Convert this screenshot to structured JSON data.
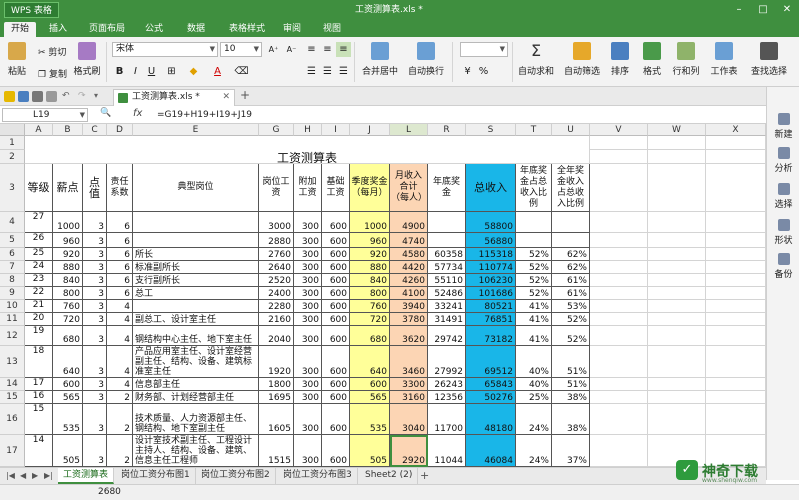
{
  "app": {
    "badge": "WPS 表格",
    "window_title": "工资测算表.xls *"
  },
  "menu_tabs": [
    "开始",
    "插入",
    "页面布局",
    "公式",
    "数据",
    "表格样式",
    "审阅",
    "视图"
  ],
  "ribbon": {
    "paste": "粘贴",
    "cut": "剪切",
    "copy": "复制",
    "format_painter": "格式刷",
    "font_name": "宋体",
    "font_size": "10",
    "merge_center": "合并居中",
    "wrap_text": "自动换行",
    "auto_sum": "自动求和",
    "auto_filter": "自动筛选",
    "sort": "排序",
    "format": "格式",
    "row_col": "行和列",
    "worksheet": "工作表",
    "find_select": "查找选择",
    "percent": "%"
  },
  "doc_tab": "工资测算表.xls *",
  "formula_bar": {
    "name_box": "L19",
    "fx": "fx",
    "formula": "=G19+H19+I19+J19"
  },
  "right_sidebar": [
    "新建",
    "分析",
    "选择",
    "形状",
    "备份"
  ],
  "columns": [
    "A",
    "B",
    "C",
    "D",
    "E",
    "G",
    "H",
    "I",
    "J",
    "L",
    "R",
    "S",
    "T",
    "U",
    "V",
    "W",
    "X"
  ],
  "sheet_title": "工资测算表",
  "headers": {
    "a": "等级",
    "b": "薪点",
    "c": "点值",
    "d": "责任系数",
    "e": "典型岗位",
    "g": "岗位工资",
    "h": "附加工资",
    "i": "基础工资",
    "j": "季度奖金（每月）",
    "l": "月收入合计（每人）",
    "r": "年底奖金",
    "s": "总收入",
    "t": "年底奖金占总收入比例",
    "u": "全年奖金收入占总收入比例"
  },
  "rows": [
    {
      "row": "4",
      "a": "27",
      "b": "1000",
      "c": "3",
      "d": "6",
      "e": "",
      "g": "3000",
      "h": "300",
      "i": "600",
      "j": "1000",
      "l": "4900",
      "r": "",
      "s": "58800",
      "t": "",
      "u": ""
    },
    {
      "row": "5",
      "a": "26",
      "b": "960",
      "c": "3",
      "d": "6",
      "e": "",
      "g": "2880",
      "h": "300",
      "i": "600",
      "j": "960",
      "l": "4740",
      "r": "",
      "s": "56880",
      "t": "",
      "u": ""
    },
    {
      "row": "6",
      "a": "25",
      "b": "920",
      "c": "3",
      "d": "6",
      "e": "所长",
      "g": "2760",
      "h": "300",
      "i": "600",
      "j": "920",
      "l": "4580",
      "r": "60358",
      "s": "115318",
      "t": "52%",
      "u": "62%"
    },
    {
      "row": "7",
      "a": "24",
      "b": "880",
      "c": "3",
      "d": "6",
      "e": "标准副所长",
      "g": "2640",
      "h": "300",
      "i": "600",
      "j": "880",
      "l": "4420",
      "r": "57734",
      "s": "110774",
      "t": "52%",
      "u": "62%"
    },
    {
      "row": "8",
      "a": "23",
      "b": "840",
      "c": "3",
      "d": "6",
      "e": "支行副所长",
      "g": "2520",
      "h": "300",
      "i": "600",
      "j": "840",
      "l": "4260",
      "r": "55110",
      "s": "106230",
      "t": "52%",
      "u": "61%"
    },
    {
      "row": "9",
      "a": "22",
      "b": "800",
      "c": "3",
      "d": "6",
      "e": "总工",
      "g": "2400",
      "h": "300",
      "i": "600",
      "j": "800",
      "l": "4100",
      "r": "52486",
      "s": "101686",
      "t": "52%",
      "u": "61%"
    },
    {
      "row": "10",
      "a": "21",
      "b": "760",
      "c": "3",
      "d": "4",
      "e": "",
      "g": "2280",
      "h": "300",
      "i": "600",
      "j": "760",
      "l": "3940",
      "r": "33241",
      "s": "80521",
      "t": "41%",
      "u": "53%"
    },
    {
      "row": "11",
      "a": "20",
      "b": "720",
      "c": "3",
      "d": "4",
      "e": "副总工、设计室主任",
      "g": "2160",
      "h": "300",
      "i": "600",
      "j": "720",
      "l": "3780",
      "r": "31491",
      "s": "76851",
      "t": "41%",
      "u": "52%"
    },
    {
      "row": "12",
      "a": "19",
      "b": "680",
      "c": "3",
      "d": "4",
      "e": "钢结构中心主任、地下室主任",
      "g": "2040",
      "h": "300",
      "i": "600",
      "j": "680",
      "l": "3620",
      "r": "29742",
      "s": "73182",
      "t": "41%",
      "u": "52%"
    },
    {
      "row": "13",
      "a": "18",
      "b": "640",
      "c": "3",
      "d": "4",
      "e": "产品应用室主任、设计室经营副主任、结构、设备、建筑标准室主任",
      "g": "1920",
      "h": "300",
      "i": "600",
      "j": "640",
      "l": "3460",
      "r": "27992",
      "s": "69512",
      "t": "40%",
      "u": "51%"
    },
    {
      "row": "14",
      "a": "17",
      "b": "600",
      "c": "3",
      "d": "4",
      "e": "信息部主任",
      "g": "1800",
      "h": "300",
      "i": "600",
      "j": "600",
      "l": "3300",
      "r": "26243",
      "s": "65843",
      "t": "40%",
      "u": "51%"
    },
    {
      "row": "15",
      "a": "16",
      "b": "565",
      "c": "3",
      "d": "2",
      "e": "财务部、计划经营部主任",
      "g": "1695",
      "h": "300",
      "i": "600",
      "j": "565",
      "l": "3160",
      "r": "12356",
      "s": "50276",
      "t": "25%",
      "u": "38%"
    },
    {
      "row": "16",
      "a": "15",
      "b": "535",
      "c": "3",
      "d": "2",
      "e": "技术质量、人力资源部主任、钢结构、地下室副主任",
      "g": "1605",
      "h": "300",
      "i": "600",
      "j": "535",
      "l": "3040",
      "r": "11700",
      "s": "48180",
      "t": "24%",
      "u": "38%"
    },
    {
      "row": "17",
      "a": "14",
      "b": "505",
      "c": "3",
      "d": "2",
      "e": "设计室技术副主任、工程设计主持人、结构、设备、建筑、信息主任工程师",
      "g": "1515",
      "h": "300",
      "i": "600",
      "j": "505",
      "l": "2920",
      "r": "11044",
      "s": "46084",
      "t": "24%",
      "u": "37%"
    }
  ],
  "sheet_tabs": [
    "工资测算表",
    "岗位工资分布图1",
    "岗位工资分布图2",
    "岗位工资分布图3",
    "Sheet2 (2)"
  ],
  "status_value": "2680",
  "watermark": {
    "text": "神奇下载",
    "url": "www.shenqiw.com"
  }
}
